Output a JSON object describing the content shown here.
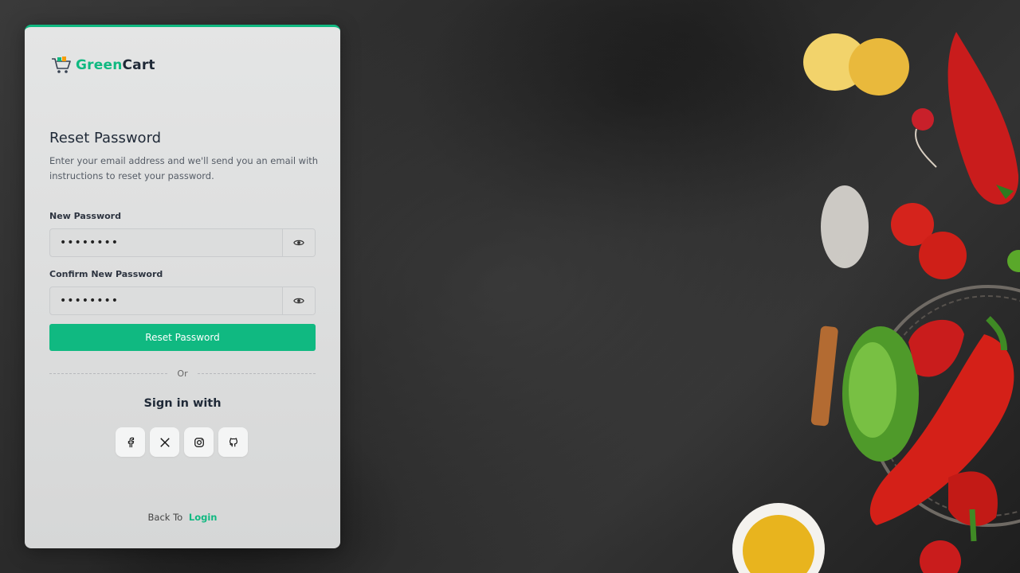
{
  "brand": {
    "name_part1": "Green",
    "name_part2": "Cart",
    "accent_color": "#10b981",
    "logo_icon": "shopping-cart-icon"
  },
  "form": {
    "title": "Reset Password",
    "description": "Enter your email address and we'll send you an email with instructions to reset your password.",
    "new_password": {
      "label": "New Password",
      "value": "••••••••",
      "toggle_icon": "eye-icon"
    },
    "confirm_password": {
      "label": "Confirm New Password",
      "value": "••••••••",
      "toggle_icon": "eye-icon"
    },
    "submit_label": "Reset Password"
  },
  "divider": {
    "text": "Or"
  },
  "social": {
    "heading": "Sign in with",
    "providers": [
      {
        "name": "facebook",
        "icon": "facebook-icon"
      },
      {
        "name": "x",
        "icon": "x-icon"
      },
      {
        "name": "instagram",
        "icon": "instagram-icon"
      },
      {
        "name": "github",
        "icon": "github-icon"
      }
    ]
  },
  "footer": {
    "back_text": "Back To",
    "login_link": "Login"
  }
}
